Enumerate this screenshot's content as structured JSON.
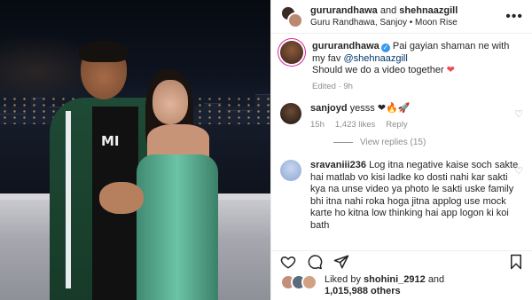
{
  "header": {
    "account_a": "gururandhawa",
    "joiner": "and",
    "account_b": "shehnaazgill",
    "subtitle": "Guru Randhawa, Sanjoy • Moon Rise",
    "more_icon": "more-horizontal-icon"
  },
  "media": {
    "shirt_text": "MI"
  },
  "caption": {
    "username": "gururandhawa",
    "text_1": "Pai gayian shaman ne with my fav",
    "mention": "@shehnaazgill",
    "text_2": "Should we do a video together",
    "emoji": "❤",
    "meta": "Edited · 9h"
  },
  "comments": [
    {
      "username": "sanjoyd",
      "text": "yesss ❤🔥🚀",
      "time": "15h",
      "likes": "1,423 likes",
      "reply": "Reply",
      "view_replies": "View replies (15)"
    },
    {
      "username": "sravaniii236",
      "text": "Log itna negative kaise soch sakte hai matlab vo kisi ladke ko dosti nahi kar sakti kya na unse video ya photo le sakti uske family bhi itna nahi roka hoga jitna applog use mock karte ho kitna low thinking hai app logon ki koi bath"
    }
  ],
  "actions": {
    "like_icon": "heart-icon",
    "comment_icon": "comment-icon",
    "share_icon": "share-icon",
    "save_icon": "bookmark-icon"
  },
  "likes": {
    "prefix": "Liked by",
    "user": "shohini_2912",
    "middle": "and",
    "count": "1,015,988 others"
  },
  "colors": {
    "link": "#00376b",
    "muted": "#8e8e8e",
    "verified": "#3897f0",
    "heart": "#ed4956"
  }
}
